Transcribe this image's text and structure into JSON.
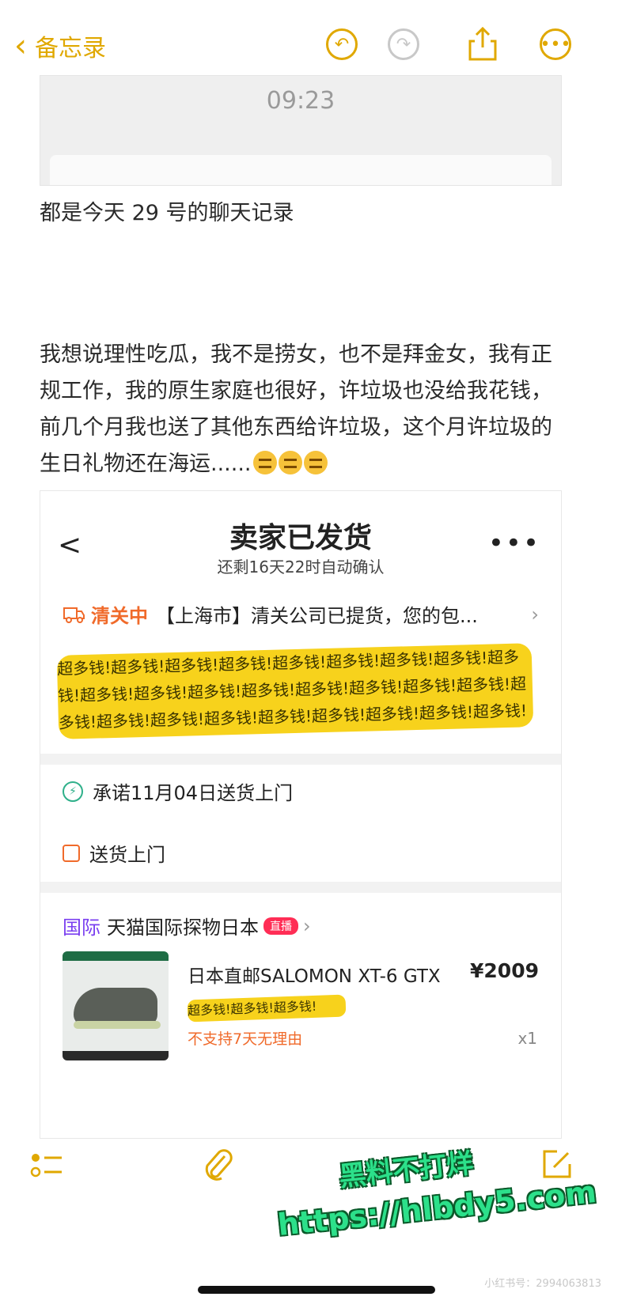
{
  "nav": {
    "back_label": "备忘录",
    "icons": [
      "undo-icon",
      "redo-icon",
      "share-icon",
      "more-icon"
    ]
  },
  "embedded_chat": {
    "time": "09:23"
  },
  "note": {
    "line1": "都是今天 29 号的聊天记录",
    "paragraph": "我想说理性吃瓜，我不是捞女，也不是拜金女，我有正规工作，我的原生家庭也很好，许垃圾也没给我花钱，前几个月我也送了其他东西给许垃圾，这个月许垃圾的生日礼物还在海运......"
  },
  "order": {
    "back_glyph": "<",
    "title": "卖家已发货",
    "subtitle": "还剩16天22时自动确认",
    "more_glyph": "•••",
    "logistics_status": "清关中",
    "logistics_text": "【上海市】清关公司已提货，您的包...",
    "censor_text": "超多钱!超多钱!超多钱!超多钱!超多钱!超多钱!超多钱!超多钱!超多钱!超多钱!超多钱!超多钱!超多钱!超多钱!超多钱!超多钱!超多钱!超多钱!超多钱!超多钱!超多钱!超多钱!超多钱!超多钱!超多钱!超多钱!超多钱!超多钱!",
    "promise": "承诺11月04日送货上门",
    "delivery": "送货上门",
    "store_tag": "国际",
    "store_name": "天猫国际探物日本",
    "live_badge": "直播",
    "product_name": "日本直邮SALOMON XT-6 GTX",
    "price": "¥2009",
    "spec_censor": "超多钱!超多钱!超多钱!",
    "return_policy": "不支持7天无理由",
    "quantity": "x1"
  },
  "toolbar": {
    "icons": [
      "checklist-icon",
      "attachment-icon",
      "compose-icon"
    ]
  },
  "watermark": {
    "line1": "黑料不打烊",
    "line2": "https://hlbdy5.com",
    "corner": "小红书号：2994063813"
  },
  "colors": {
    "accent": "#e0a800",
    "orange": "#f06a2a",
    "censor": "#f7d21c",
    "watermark": "#2ce08a"
  }
}
